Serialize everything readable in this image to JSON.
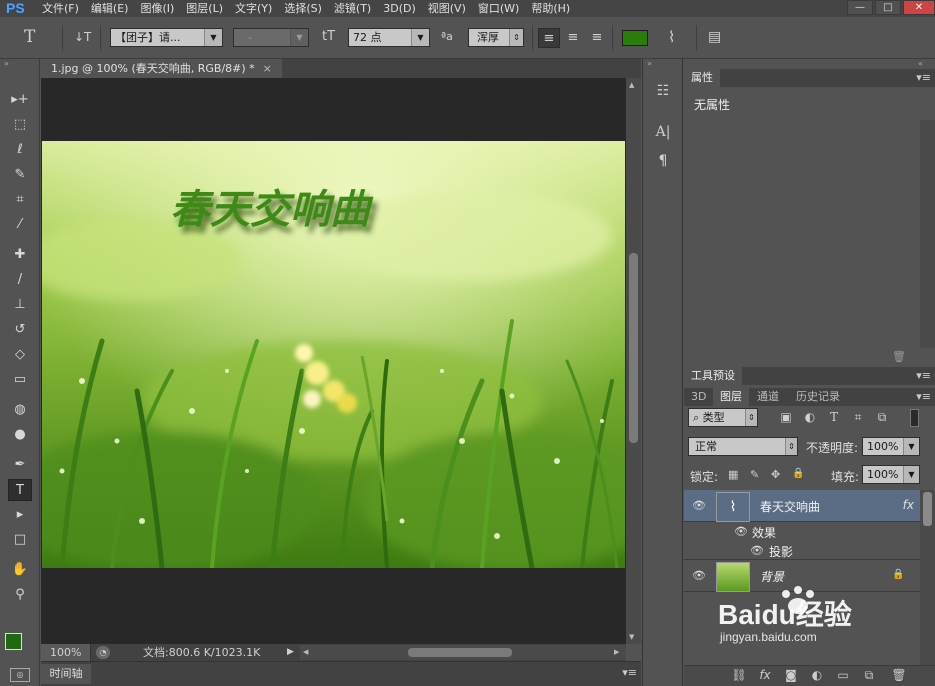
{
  "app": {
    "logo": "PS"
  },
  "menu": [
    "文件(F)",
    "编辑(E)",
    "图像(I)",
    "图层(L)",
    "文字(Y)",
    "选择(S)",
    "滤镜(T)",
    "3D(D)",
    "视图(V)",
    "窗口(W)",
    "帮助(H)"
  ],
  "window_controls": {
    "minimize": "—",
    "maximize": "□",
    "close": "✕"
  },
  "options": {
    "tool_glyph": "T",
    "orient_glyph": "↓T",
    "font_family": "【团子】请...",
    "font_style": "-",
    "size_glyph": "tT",
    "font_size": "72 点",
    "aa_glyph": "ªa",
    "antialias": "浑厚",
    "align_left": "≡",
    "align_center": "≡",
    "align_right": "≡",
    "text_color": "#2b7d0b",
    "warp_glyph": "⌇",
    "panels_glyph": "▤"
  },
  "document": {
    "tab_title": "1.jpg @ 100% (春天交响曲, RGB/8#) *",
    "tab_close": "×",
    "zoom": "100%",
    "doc_info": "文档:800.6 K/1023.1K",
    "art_text": "春天交响曲"
  },
  "timeline": {
    "label": "时间轴"
  },
  "tools": [
    {
      "name": "move-tool",
      "glyph": "▸+"
    },
    {
      "name": "marquee-tool",
      "glyph": "⬚"
    },
    {
      "name": "lasso-tool",
      "glyph": "ℓ"
    },
    {
      "name": "quick-select-tool",
      "glyph": "✎"
    },
    {
      "name": "crop-tool",
      "glyph": "⌗"
    },
    {
      "name": "eyedropper-tool",
      "glyph": "⁄"
    },
    {
      "name": "healing-brush-tool",
      "glyph": "✚"
    },
    {
      "name": "brush-tool",
      "glyph": "/"
    },
    {
      "name": "clone-stamp-tool",
      "glyph": "⊥"
    },
    {
      "name": "history-brush-tool",
      "glyph": "↺"
    },
    {
      "name": "eraser-tool",
      "glyph": "◇"
    },
    {
      "name": "gradient-tool",
      "glyph": "▭"
    },
    {
      "name": "blur-tool",
      "glyph": "◍"
    },
    {
      "name": "dodge-tool",
      "glyph": "●"
    },
    {
      "name": "pen-tool",
      "glyph": "✒"
    },
    {
      "name": "type-tool",
      "glyph": "T"
    },
    {
      "name": "path-select-tool",
      "glyph": "▸"
    },
    {
      "name": "shape-tool",
      "glyph": "□"
    },
    {
      "name": "hand-tool",
      "glyph": "✋"
    },
    {
      "name": "zoom-tool",
      "glyph": "⚲"
    }
  ],
  "colors": {
    "foreground": "#1f6a10",
    "background": "#ffffff"
  },
  "properties_panel": {
    "tab": "属性",
    "content": "无属性",
    "menu_glyph": "▾≡"
  },
  "tool_presets_panel": {
    "tab": "工具预设"
  },
  "layers_panel": {
    "tabs": [
      "3D",
      "图层",
      "通道",
      "历史记录"
    ],
    "filter_kind": "类型",
    "filter_icon_search": "⌕",
    "filter_icons": [
      "▣",
      "◐",
      "T",
      "⌗",
      "⧉"
    ],
    "blend_mode": "正常",
    "opacity_label": "不透明度:",
    "opacity_value": "100%",
    "lock_label": "锁定:",
    "lock_icons": [
      "▦",
      "✎",
      "✥",
      "🔒"
    ],
    "fill_label": "填充:",
    "fill_value": "100%",
    "layers": [
      {
        "name": "春天交响曲",
        "type": "text",
        "fx": "fx",
        "selected": true
      },
      {
        "name": "效果",
        "sub": true,
        "level": 1
      },
      {
        "name": "投影",
        "sub": true,
        "level": 2
      },
      {
        "name": "背景",
        "type": "image",
        "locked": true,
        "lock_glyph": "🔒"
      }
    ],
    "bottom_icons": [
      "⛓",
      "fx",
      "◙",
      "◐",
      "▭",
      "⧉",
      "🗑"
    ]
  },
  "watermark": {
    "text": "Baidu经验",
    "url": "jingyan.baidu.com"
  }
}
